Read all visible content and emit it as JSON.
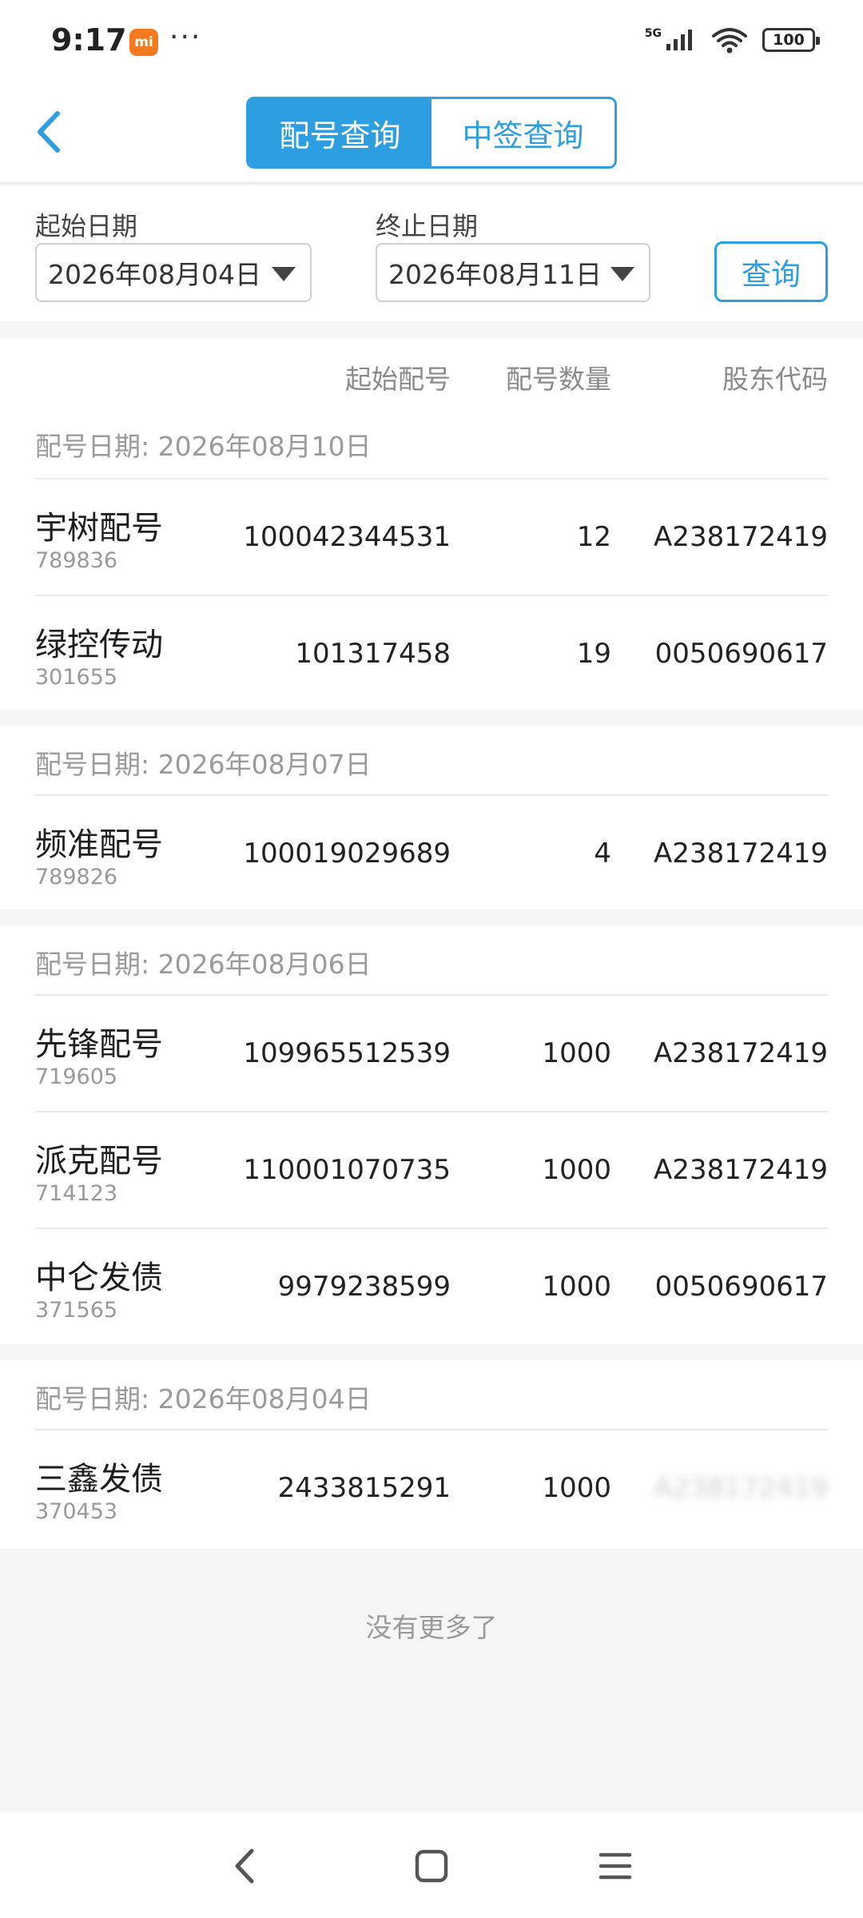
{
  "status_bar": {
    "time": "9:17",
    "app_badge": "mi",
    "more": "···",
    "network": "5G",
    "battery": "100"
  },
  "header": {
    "back_icon": "chevron-left-icon",
    "tabs": [
      {
        "label": "配号查询",
        "active": true
      },
      {
        "label": "中签查询",
        "active": false
      }
    ]
  },
  "filter": {
    "start_label": "起始日期",
    "start_value": "2026年08月04日",
    "end_label": "终止日期",
    "end_value": "2026年08月11日",
    "query_button": "查询"
  },
  "table": {
    "columns": [
      "起始配号",
      "配号数量",
      "股东代码"
    ],
    "groups": [
      {
        "date_label": "配号日期: 2026年08月10日",
        "rows": [
          {
            "name": "宇树配号",
            "code": "789836",
            "start": "100042344531",
            "qty": "12",
            "account": "A238172419"
          },
          {
            "name": "绿控传动",
            "code": "301655",
            "start": "101317458",
            "qty": "19",
            "account": "0050690617"
          }
        ]
      },
      {
        "date_label": "配号日期: 2026年08月07日",
        "rows": [
          {
            "name": "频准配号",
            "code": "789826",
            "start": "100019029689",
            "qty": "4",
            "account": "A238172419"
          }
        ]
      },
      {
        "date_label": "配号日期: 2026年08月06日",
        "rows": [
          {
            "name": "先锋配号",
            "code": "719605",
            "start": "109965512539",
            "qty": "1000",
            "account": "A238172419"
          },
          {
            "name": "派克配号",
            "code": "714123",
            "start": "110001070735",
            "qty": "1000",
            "account": "A238172419"
          },
          {
            "name": "中仑发债",
            "code": "371565",
            "start": "9979238599",
            "qty": "1000",
            "account": "0050690617"
          }
        ]
      },
      {
        "date_label": "配号日期: 2026年08月04日",
        "rows": [
          {
            "name": "三鑫发债",
            "code": "370453",
            "start": "2433815291",
            "qty": "1000",
            "account": ""
          }
        ]
      }
    ]
  },
  "footer": {
    "no_more": "没有更多了"
  },
  "nav_bar": {
    "icons": [
      "back-icon",
      "home-icon",
      "menu-icon"
    ]
  },
  "colors": {
    "accent": "#2d9fe0",
    "background": "#f5f5f5"
  }
}
